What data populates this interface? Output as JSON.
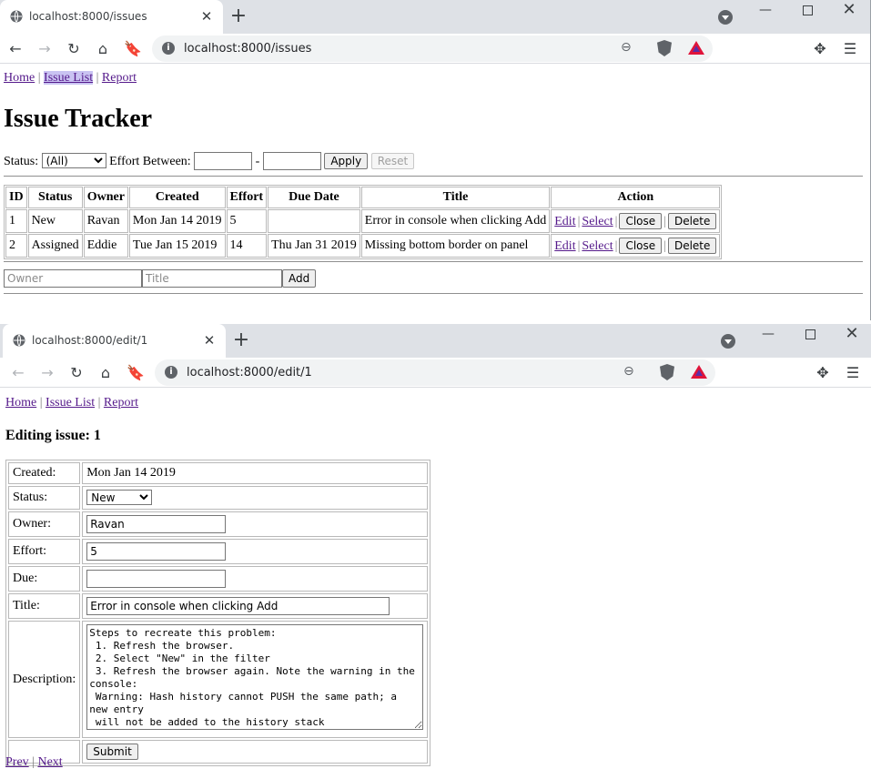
{
  "window1": {
    "tab_title": "localhost:8000/issues",
    "url": "localhost:8000/issues",
    "nav": {
      "home": "Home",
      "issue_list": "Issue List",
      "report": "Report",
      "sep": "|"
    },
    "heading": "Issue Tracker",
    "filter": {
      "status_label": "Status:",
      "status_value": "(All)",
      "effort_label": "Effort Between:",
      "dash": "-",
      "apply": "Apply",
      "reset": "Reset"
    },
    "table": {
      "headers": [
        "ID",
        "Status",
        "Owner",
        "Created",
        "Effort",
        "Due Date",
        "Title",
        "Action"
      ],
      "rows": [
        {
          "id": "1",
          "status": "New",
          "owner": "Ravan",
          "created": "Mon Jan 14 2019",
          "effort": "5",
          "due": "",
          "title": "Error in console when clicking Add"
        },
        {
          "id": "2",
          "status": "Assigned",
          "owner": "Eddie",
          "created": "Tue Jan 15 2019",
          "effort": "14",
          "due": "Thu Jan 31 2019",
          "title": "Missing bottom border on panel"
        }
      ],
      "actions": {
        "edit": "Edit",
        "select": "Select",
        "close": "Close",
        "delete": "Delete",
        "sep": "|"
      }
    },
    "add_form": {
      "owner_placeholder": "Owner",
      "title_placeholder": "Title",
      "add": "Add"
    }
  },
  "window2": {
    "tab_title": "localhost:8000/edit/1",
    "url": "localhost:8000/edit/1",
    "nav": {
      "home": "Home",
      "issue_list": "Issue List",
      "report": "Report",
      "sep": "|"
    },
    "heading": "Editing issue: 1",
    "form": {
      "created_label": "Created:",
      "created_value": "Mon Jan 14 2019",
      "status_label": "Status:",
      "status_value": "New",
      "owner_label": "Owner:",
      "owner_value": "Ravan",
      "effort_label": "Effort:",
      "effort_value": "5",
      "due_label": "Due:",
      "due_value": "",
      "title_label": "Title:",
      "title_value": "Error in console when clicking Add",
      "description_label": "Description:",
      "description_value": "Steps to recreate this problem:\n 1. Refresh the browser.\n 2. Select \"New\" in the filter\n 3. Refresh the browser again. Note the warning in the console:\n Warning: Hash history cannot PUSH the same path; a new entry\n will not be added to the history stack",
      "submit": "Submit"
    },
    "pager": {
      "prev": "Prev",
      "next": "Next",
      "sep": "|"
    }
  },
  "icons": {
    "back": "back-arrow-icon",
    "forward": "forward-arrow-icon",
    "reload": "reload-icon",
    "home": "home-icon",
    "bookmark": "bookmark-icon",
    "info": "info-icon",
    "zoom": "zoom-out-icon",
    "brave": "brave-shield-icon",
    "rewards": "brave-rewards-icon",
    "extensions": "puzzle-icon",
    "menu": "menu-icon"
  },
  "colors": {
    "tabstrip": "#dee1e6",
    "omnibox": "#f1f3f4",
    "link": "#551a8b",
    "active_link_bg": "#c9c3f2"
  }
}
